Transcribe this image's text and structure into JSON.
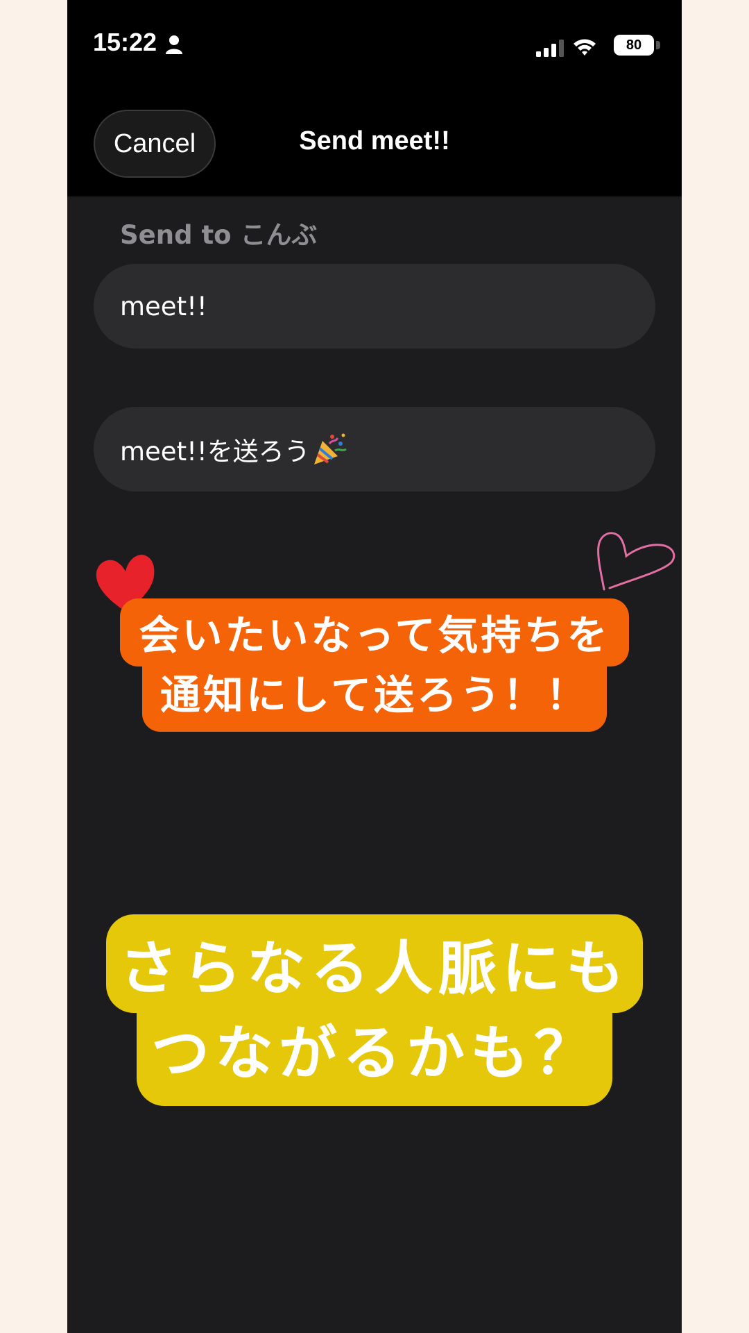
{
  "status_bar": {
    "time": "15:22",
    "battery": "80"
  },
  "nav": {
    "cancel_label": "Cancel",
    "title": "Send meet!!"
  },
  "form": {
    "send_to": "Send to こんぶ",
    "field1_value": "meet!!",
    "field2_value": "meet!!を送ろう"
  },
  "captions": {
    "orange_line1": "会いたいなって気持ちを",
    "orange_line2": "通知にして送ろう！！",
    "yellow_line1": "さらなる人脈にも",
    "yellow_line2": "つながるかも？"
  },
  "colors": {
    "accent_orange": "#f56309",
    "accent_yellow": "#e6c80b",
    "background_outer": "#fbf3e9",
    "screen_bg": "#1c1c1e"
  },
  "icons": [
    "person-icon",
    "cellular-signal-icon",
    "wifi-icon",
    "battery-icon",
    "party-popper-icon",
    "red-heart-icon",
    "pink-heart-outline-icon"
  ]
}
